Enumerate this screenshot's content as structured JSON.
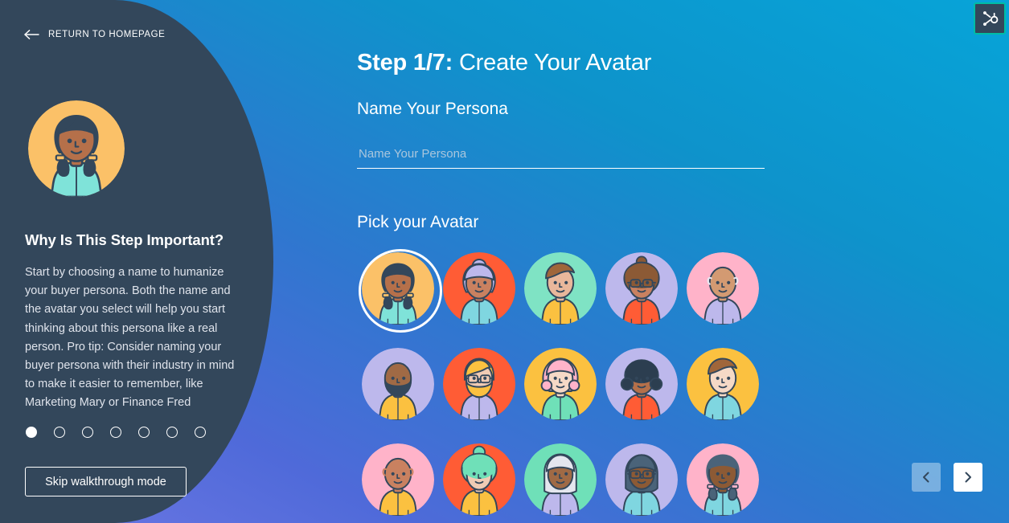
{
  "sidebar": {
    "return_link": {
      "label": "RETURN TO HOMEPAGE",
      "icon": "arrow-left-icon"
    },
    "avatar": {
      "name": "persona-avatar",
      "background": "#FBC168",
      "skin": "#B5704A",
      "hair": "#33475B",
      "shirt": "#7FE3D9"
    },
    "why_title": "Why Is This Step Important?",
    "why_body": "Start by choosing a name to humanize your buyer persona. Both the name and the avatar you select will help you start thinking about this persona like a real person. Pro tip: Consider naming your buyer persona with their industry in mind to make it easier to remember, like Marketing Mary or Finance Fred",
    "progress": {
      "total": 7,
      "current": 1
    },
    "skip_button": "Skip walkthrough mode",
    "background_color": "#33475B"
  },
  "main": {
    "step_prefix": "Step 1/7:",
    "step_title": "Create Your Avatar",
    "name_label": "Name Your Persona",
    "name_input": {
      "value": "",
      "placeholder": "Name Your Persona"
    },
    "pick_label": "Pick your Avatar",
    "gradient": {
      "from": "#07A4D8",
      "to": "#6D77E4"
    },
    "avatars": [
      {
        "id": "avatar-1",
        "bg": "#FBC168",
        "skin": "#B5704A",
        "hair": "#33475B",
        "shirt": "#7FE3D9",
        "style": "braids",
        "selected": true
      },
      {
        "id": "avatar-2",
        "bg": "#FF5C35",
        "skin": "#C98160",
        "hair": "#BDB8EC",
        "shirt": "#7FD6E0",
        "style": "bun",
        "selected": false
      },
      {
        "id": "avatar-3",
        "bg": "#7FE3C4",
        "skin": "#E9B79B",
        "hair": "#A0663A",
        "shirt": "#FBC140",
        "style": "swoop",
        "selected": false
      },
      {
        "id": "avatar-4",
        "bg": "#BDB8EC",
        "skin": "#C98160",
        "hair": "#8C5A35",
        "shirt": "#FF5C35",
        "style": "afro-glasses",
        "selected": false
      },
      {
        "id": "avatar-5",
        "bg": "#FFB3C9",
        "skin": "#D39A72",
        "hair": "#E8E8F2",
        "shirt": "#BDB8EC",
        "style": "bald",
        "selected": false
      },
      {
        "id": "avatar-6",
        "bg": "#BDB8EC",
        "skin": "#A06A45",
        "hair": "#33475B",
        "shirt": "#FBC140",
        "style": "beard-bald",
        "selected": false
      },
      {
        "id": "avatar-7",
        "bg": "#FF5C35",
        "skin": "#F0CBB4",
        "hair": "#FBC140",
        "shirt": "#BDB8EC",
        "style": "beard-glasses",
        "selected": false
      },
      {
        "id": "avatar-8",
        "bg": "#FBC140",
        "skin": "#F5D9C6",
        "hair": "#FFB3C9",
        "shirt": "#6FE0B8",
        "style": "wavy",
        "selected": false
      },
      {
        "id": "avatar-9",
        "bg": "#BDB8EC",
        "skin": "#B5704A",
        "hair": "#2C3E50",
        "shirt": "#FF5C35",
        "style": "curly",
        "selected": false
      },
      {
        "id": "avatar-10",
        "bg": "#FBC140",
        "skin": "#F5D9C6",
        "hair": "#A0663A",
        "shirt": "#7FD6E0",
        "style": "swoop",
        "selected": false
      },
      {
        "id": "avatar-11",
        "bg": "#FFB3C9",
        "skin": "#C98160",
        "hair": "#C98160",
        "shirt": "#FBC140",
        "style": "bald",
        "selected": false
      },
      {
        "id": "avatar-12",
        "bg": "#FF5C35",
        "skin": "#F0CBB4",
        "hair": "#6FE0B8",
        "shirt": "#FBC140",
        "style": "afro-bun",
        "selected": false
      },
      {
        "id": "avatar-13",
        "bg": "#6FE0B8",
        "skin": "#A06A45",
        "hair": "#E4E6EE",
        "shirt": "#BDB8EC",
        "style": "long-white",
        "selected": false
      },
      {
        "id": "avatar-14",
        "bg": "#BDB8EC",
        "skin": "#8C5A35",
        "hair": "#4A6379",
        "shirt": "#7FD6E0",
        "style": "bob-glasses",
        "selected": false
      },
      {
        "id": "avatar-15",
        "bg": "#FFB3C9",
        "skin": "#8C5A35",
        "hair": "#4A6379",
        "shirt": "#7FD6E0",
        "style": "braids",
        "selected": false
      }
    ],
    "nav": {
      "prev": "previous-page",
      "next": "next-page"
    }
  },
  "widget": {
    "name": "hubspot-sprocket",
    "border_color": "#00BDA5",
    "background": "#33475B"
  }
}
